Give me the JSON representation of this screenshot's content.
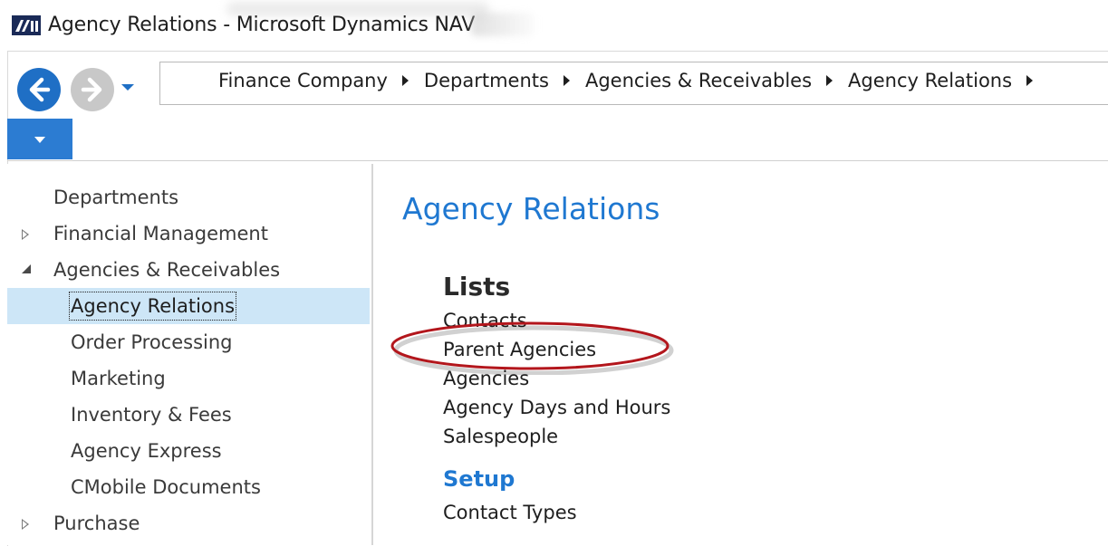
{
  "window": {
    "title": "Agency Relations - Microsoft Dynamics NAV"
  },
  "navigation": {
    "back_icon": "arrow-left-icon",
    "forward_icon": "arrow-right-icon",
    "history_dropdown_icon": "chevron-down-icon"
  },
  "breadcrumb": {
    "items": [
      "Finance Company",
      "Departments",
      "Agencies & Receivables",
      "Agency Relations"
    ]
  },
  "ribbon": {
    "toggle_icon": "triangle-down-icon"
  },
  "sidebar": {
    "items": [
      {
        "label": "Departments",
        "level": 0,
        "expander": "none"
      },
      {
        "label": "Financial Management",
        "level": 0,
        "expander": "collapsed"
      },
      {
        "label": "Agencies & Receivables",
        "level": 0,
        "expander": "expanded"
      },
      {
        "label": "Agency Relations",
        "level": 1,
        "expander": "none",
        "selected": true
      },
      {
        "label": "Order Processing",
        "level": 1,
        "expander": "none"
      },
      {
        "label": "Marketing",
        "level": 1,
        "expander": "none"
      },
      {
        "label": "Inventory & Fees",
        "level": 1,
        "expander": "none"
      },
      {
        "label": "Agency Express",
        "level": 1,
        "expander": "none"
      },
      {
        "label": "CMobile Documents",
        "level": 1,
        "expander": "none"
      },
      {
        "label": "Purchase",
        "level": 0,
        "expander": "collapsed"
      }
    ]
  },
  "main": {
    "title": "Agency Relations",
    "sections": [
      {
        "heading": "Lists",
        "links": [
          "Contacts",
          "Parent Agencies",
          "Agencies",
          "Agency Days and Hours",
          "Salespeople"
        ]
      },
      {
        "heading": "Setup",
        "links": [
          "Contact Types"
        ]
      }
    ],
    "highlighted_link": "Parent Agencies"
  },
  "colors": {
    "accent": "#1f78d1",
    "back_button": "#1f6fc5",
    "forward_button": "#c8c8c8",
    "selection": "#cde6f7",
    "annotation_ellipse": "#b3161c"
  }
}
